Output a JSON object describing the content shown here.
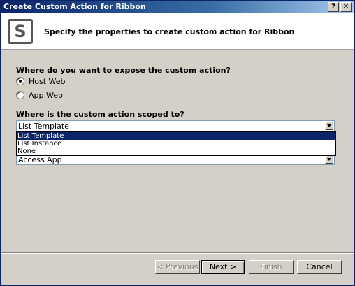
{
  "window": {
    "title": "Create Custom Action for Ribbon",
    "help_label": "?",
    "close_label": "✕"
  },
  "header": {
    "logo_letter": "S",
    "text": "Specify the properties to create custom action for Ribbon"
  },
  "expose": {
    "question": "Where do you want to expose the custom action?",
    "options": [
      {
        "label": "Host Web",
        "checked": true
      },
      {
        "label": "App Web",
        "checked": false
      }
    ]
  },
  "scope": {
    "question": "Where is the custom action scoped to?",
    "selected_value": "List Template",
    "dropdown_options": [
      "List Template",
      "List Instance",
      "None"
    ],
    "underlying_value": "Access App"
  },
  "footer": {
    "previous_label": "< Previous",
    "next_label": "Next >",
    "finish_label": "Finish",
    "cancel_label": "Cancel"
  }
}
